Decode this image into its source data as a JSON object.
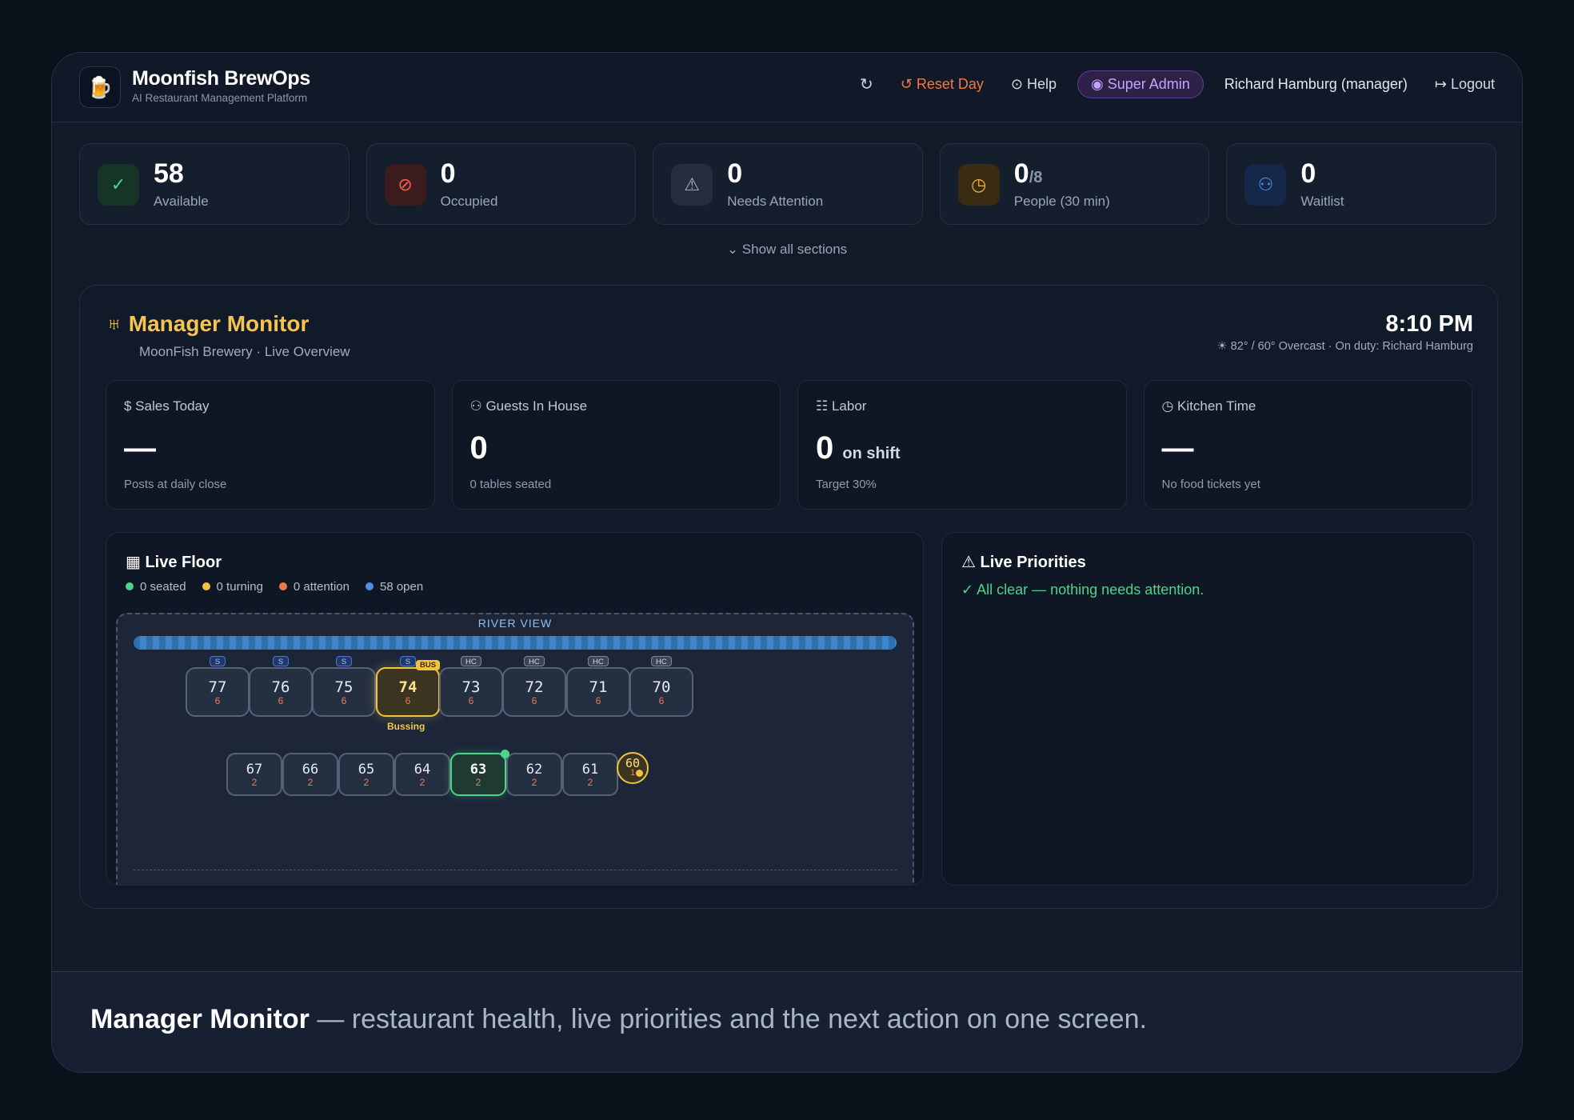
{
  "header": {
    "app_title": "Moonfish BrewOps",
    "app_subtitle": "AI Restaurant Management Platform",
    "refresh_icon": "↻",
    "reset_day": "↺ Reset Day",
    "help": "⊙ Help",
    "role_badge": "◉ Super Admin",
    "user": "Richard Hamburg (manager)",
    "logout": "↦ Logout"
  },
  "stats": [
    {
      "icon": "check-icon",
      "glyph": "✓",
      "value": "58",
      "suffix": "",
      "label": "Available"
    },
    {
      "icon": "ban-icon",
      "glyph": "⊘",
      "value": "0",
      "suffix": "",
      "label": "Occupied"
    },
    {
      "icon": "warning-icon",
      "glyph": "⚠",
      "value": "0",
      "suffix": "",
      "label": "Needs Attention"
    },
    {
      "icon": "clock-icon",
      "glyph": "◷",
      "value": "0",
      "suffix": "/8",
      "label": "People (30 min)"
    },
    {
      "icon": "people-icon",
      "glyph": "⚇",
      "value": "0",
      "suffix": "",
      "label": "Waitlist"
    }
  ],
  "show_all": "⌄ Show all sections",
  "monitor": {
    "title": "♅ Manager Monitor",
    "subtitle": "MoonFish Brewery · Live Overview",
    "time": "8:10 PM",
    "weather": "☀ 82° / 60° Overcast · On duty: Richard Hamburg"
  },
  "kpis": [
    {
      "label": "$ Sales Today",
      "value": "—",
      "unit": "",
      "note": "Posts at daily close"
    },
    {
      "label": "⚇ Guests In House",
      "value": "0",
      "unit": "",
      "note": "0 tables seated"
    },
    {
      "label": "☷ Labor",
      "value": "0",
      "unit": "on shift",
      "note": "Target 30%"
    },
    {
      "label": "◷ Kitchen Time",
      "value": "—",
      "unit": "",
      "note": "No food tickets yet"
    }
  ],
  "floor": {
    "title": "▦ Live Floor",
    "legend": [
      {
        "label": "0 seated",
        "color": "#4bd58b"
      },
      {
        "label": "0 turning",
        "color": "#f2c341"
      },
      {
        "label": "0 attention",
        "color": "#f07a45"
      },
      {
        "label": "58 open",
        "color": "#4f8fe6"
      }
    ],
    "river_label": "RIVER VIEW",
    "row1": [
      {
        "num": "77",
        "seats": "6",
        "tag": "S"
      },
      {
        "num": "76",
        "seats": "6",
        "tag": "S"
      },
      {
        "num": "75",
        "seats": "6",
        "tag": "S"
      },
      {
        "num": "74",
        "seats": "6",
        "tag": "S",
        "bus": "BUS",
        "status": "Bussing"
      },
      {
        "num": "73",
        "seats": "6",
        "tag": "HC"
      },
      {
        "num": "72",
        "seats": "6",
        "tag": "HC"
      },
      {
        "num": "71",
        "seats": "6",
        "tag": "HC"
      },
      {
        "num": "70",
        "seats": "6",
        "tag": "HC"
      }
    ],
    "row2": [
      {
        "num": "67",
        "seats": "2"
      },
      {
        "num": "66",
        "seats": "2"
      },
      {
        "num": "65",
        "seats": "2"
      },
      {
        "num": "64",
        "seats": "2"
      },
      {
        "num": "63",
        "seats": "2"
      },
      {
        "num": "62",
        "seats": "2"
      },
      {
        "num": "61",
        "seats": "2"
      },
      {
        "num": "60",
        "seats": "1"
      }
    ]
  },
  "priorities": {
    "title": "⚠ Live Priorities",
    "message": "✓ All clear — nothing needs attention."
  },
  "caption": {
    "bold": "Manager Monitor",
    "rest": " — restaurant health, live priorities and the next action on one screen."
  }
}
